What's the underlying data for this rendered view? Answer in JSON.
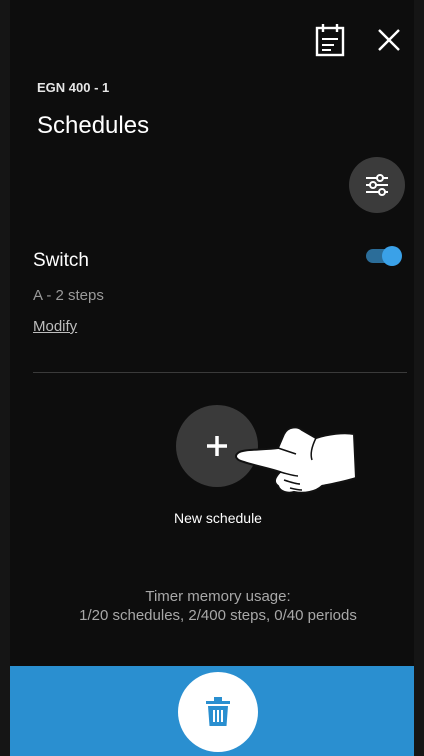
{
  "header": {
    "device_name": "EGN 400 - 1",
    "page_title": "Schedules",
    "calendar_icon": "calendar-icon",
    "close_icon": "close-icon",
    "filter_icon": "sliders-icon"
  },
  "schedules": [
    {
      "name": "Switch",
      "subtitle": "A - 2 steps",
      "modify_label": "Modify",
      "enabled": true
    }
  ],
  "new_schedule": {
    "icon": "plus-icon",
    "label": "New schedule"
  },
  "memory": {
    "heading": "Timer memory usage:",
    "details": "1/20 schedules, 2/400 steps, 0/40 periods"
  },
  "footer": {
    "delete_icon": "trash-icon"
  },
  "colors": {
    "background": "#0d0d0d",
    "accent": "#2a8fd0",
    "toggle_on": "#3aa1e8",
    "button_gray": "#3a3a3a"
  }
}
